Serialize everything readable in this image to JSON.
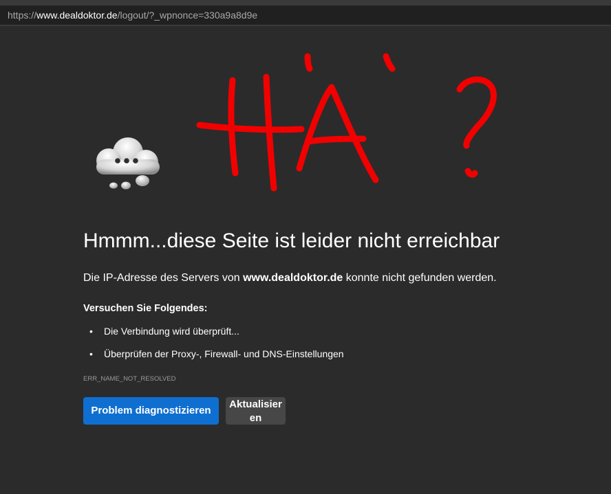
{
  "browser": {
    "url_prefix": "https://",
    "url_host": "www.dealdoktor.de",
    "url_path": "/logout/?_wpnonce=330a9a8d9e"
  },
  "page": {
    "icon": "cloud-ellipsis-icon",
    "annotation": "HÄ ?",
    "annotation_color": "#f20000",
    "title": "Hmmm...diese Seite ist leider nicht erreichbar",
    "description_before": "Die IP-Adresse des Servers von ",
    "description_host": "www.dealdoktor.de",
    "description_after": " konnte nicht gefunden werden.",
    "try_heading": "Versuchen Sie Folgendes:",
    "suggestions": [
      "Die Verbindung wird überprüft...",
      "Überprüfen der Proxy-, Firewall- und DNS-Einstellungen"
    ],
    "error_code": "ERR_NAME_NOT_RESOLVED",
    "primary_button": "Problem diagnostizieren",
    "secondary_button": "Aktualisieren",
    "primary_color": "#0f6fd0"
  }
}
